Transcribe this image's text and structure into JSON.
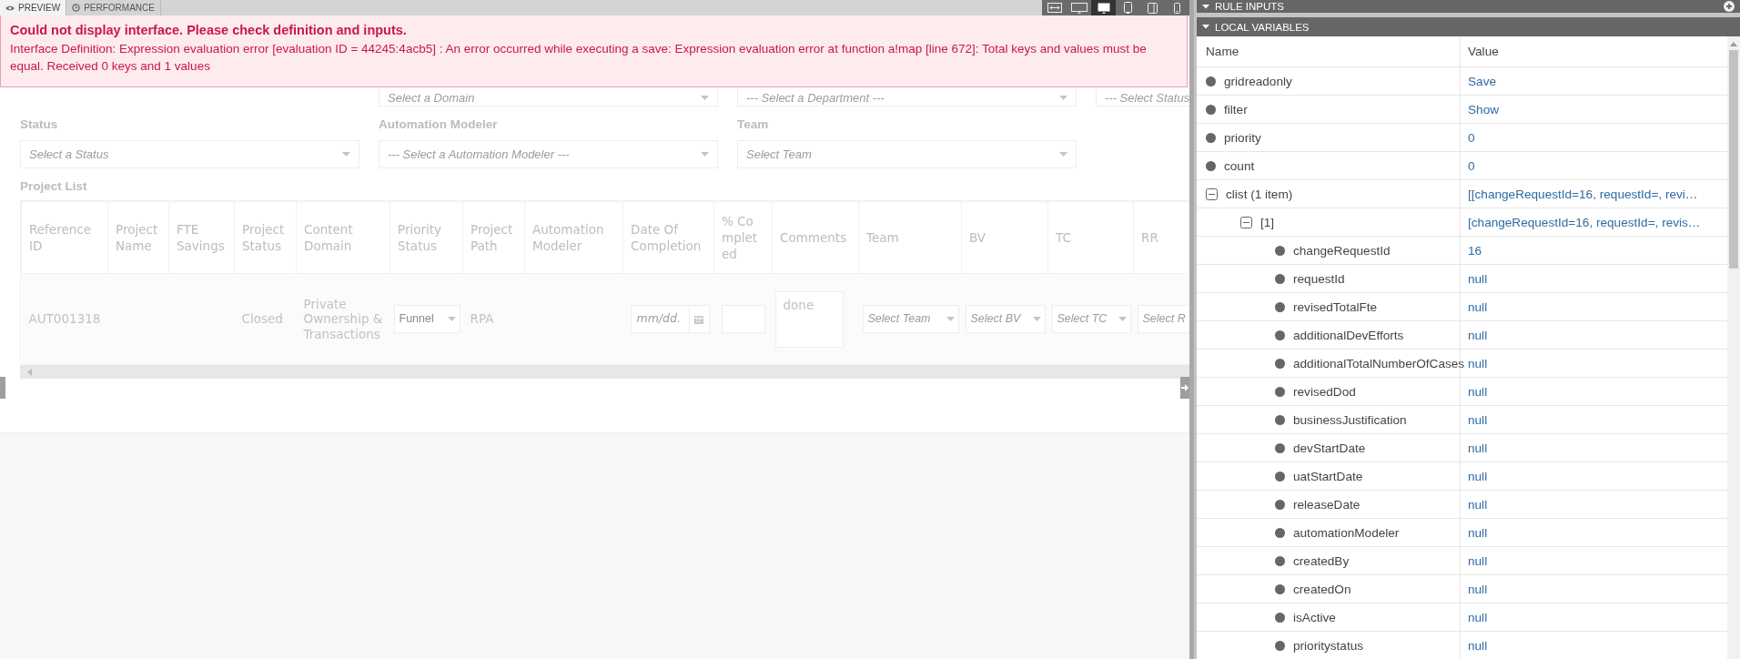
{
  "tabs": [
    {
      "label": "PREVIEW",
      "kind": "eye",
      "selected": true
    },
    {
      "label": "PERFORMANCE",
      "kind": "clock",
      "selected": false
    }
  ],
  "device_toolbar": [
    {
      "kind": "fit",
      "selected": false
    },
    {
      "kind": "wide",
      "selected": false
    },
    {
      "kind": "desktop",
      "selected": true
    },
    {
      "kind": "tablet",
      "selected": false
    },
    {
      "kind": "tablet-landscape",
      "selected": false
    },
    {
      "kind": "phone",
      "selected": false
    }
  ],
  "error": {
    "title": "Could not display interface. Please check definition and inputs.",
    "message": "Interface Definition: Expression evaluation error [evaluation ID = 44245:4acb5] : An error occurred while executing a save: Expression evaluation error at function a!map [line 672]: Total keys and values must be equal. Received 0 keys and 1 values"
  },
  "filter_rows": [
    [
      {
        "placeholder": "Select a Domain"
      },
      {
        "placeholder": "--- Select a Department ---"
      },
      {
        "placeholder": "--- Select Status"
      }
    ],
    [
      {
        "label": "Status",
        "placeholder": "Select a Status"
      },
      {
        "label": "Automation Modeler",
        "placeholder": "--- Select a Automation Modeler ---"
      },
      {
        "label": "Team",
        "placeholder": "Select Team"
      }
    ]
  ],
  "project_list": {
    "title": "Project List",
    "columns": [
      "Reference ID",
      "Project Name",
      "FTE Savings",
      "Project Status",
      "Content Domain",
      "Priority Status",
      "Project Path",
      "Automation Modeler",
      "Date Of Completion",
      "% Completed",
      "Comments",
      "Team",
      "BV",
      "TC",
      "RR"
    ],
    "rows": [
      {
        "cells": [
          {
            "kind": "text",
            "value": "AUT001318"
          },
          {
            "kind": "empty"
          },
          {
            "kind": "empty"
          },
          {
            "kind": "text",
            "value": "Closed"
          },
          {
            "kind": "text",
            "value": "Private Ownership & Transactions"
          },
          {
            "kind": "select",
            "value": "Funnel"
          },
          {
            "kind": "text",
            "value": "RPA"
          },
          {
            "kind": "empty"
          },
          {
            "kind": "date",
            "placeholder": "mm/dd."
          },
          {
            "kind": "input"
          },
          {
            "kind": "textarea",
            "value": "done"
          },
          {
            "kind": "select",
            "placeholder": "Select Team"
          },
          {
            "kind": "select",
            "placeholder": "Select BV"
          },
          {
            "kind": "select",
            "placeholder": "Select TC"
          },
          {
            "kind": "select",
            "placeholder": "Select R"
          }
        ]
      }
    ]
  },
  "panel_sections": [
    {
      "title": "RULE INPUTS",
      "expanded": true
    },
    {
      "title": "LOCAL VARIABLES",
      "expanded": true
    }
  ],
  "local_variables": {
    "columns": [
      "Name",
      "Value"
    ],
    "items": [
      {
        "name": "gridreadonly",
        "value": "Save"
      },
      {
        "name": "filter",
        "value": "Show"
      },
      {
        "name": "priority",
        "value": "0"
      },
      {
        "name": "count",
        "value": "0"
      },
      {
        "name": "clist (1 item)",
        "value": "[[changeRequestId=16, requestId=, revi…",
        "expanded": true,
        "children": [
          {
            "name": "[1]",
            "value": "[changeRequestId=16, requestId=, revis…",
            "expanded": true,
            "children": [
              {
                "name": "changeRequestId",
                "value": "16"
              },
              {
                "name": "requestId",
                "value": "null"
              },
              {
                "name": "revisedTotalFte",
                "value": "null"
              },
              {
                "name": "additionalDevEfforts",
                "value": "null"
              },
              {
                "name": "additionalTotalNumberOfCases",
                "value": "null"
              },
              {
                "name": "revisedDod",
                "value": "null"
              },
              {
                "name": "businessJustification",
                "value": "null"
              },
              {
                "name": "devStartDate",
                "value": "null"
              },
              {
                "name": "uatStartDate",
                "value": "null"
              },
              {
                "name": "releaseDate",
                "value": "null"
              },
              {
                "name": "automationModeler",
                "value": "null"
              },
              {
                "name": "createdBy",
                "value": "null"
              },
              {
                "name": "createdOn",
                "value": "null"
              },
              {
                "name": "isActive",
                "value": "null"
              },
              {
                "name": "prioritystatus",
                "value": "null"
              }
            ]
          }
        ]
      }
    ]
  }
}
